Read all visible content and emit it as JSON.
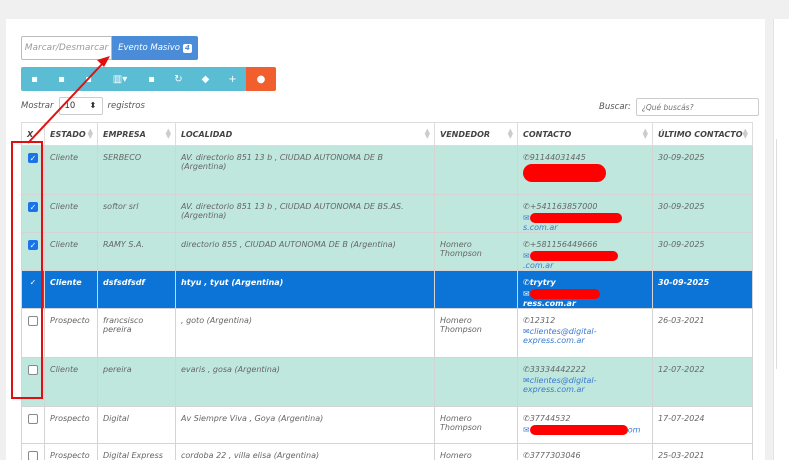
{
  "mass_actions": {
    "toggle_label": "Marcar/Desmarcar",
    "evento_label": "Evento Masivo",
    "evento_badge": "4"
  },
  "length": {
    "prefix": "Mostrar",
    "value": "10",
    "suffix": "registros"
  },
  "search": {
    "label": "Buscar:",
    "placeholder": "¿Qué buscás?"
  },
  "columns": [
    "X",
    "ESTADO",
    "EMPRESA",
    "LOCALIDAD",
    "VENDEDOR",
    "CONTACTO",
    "ÚLTIMO CONTACTO"
  ],
  "rows": [
    {
      "checked": true,
      "estado": "Cliente",
      "empresa": "SERBECO",
      "localidad": "AV. directorio 851 13 b , CIUDAD AUTONOMA DE B (Argentina)",
      "vendedor": "",
      "phone": "91144031445",
      "email_suffix": "",
      "ultimo": "30-09-2025"
    },
    {
      "checked": true,
      "estado": "Cliente",
      "empresa": "softor srl",
      "localidad": "AV. directorio 851 13 b , CIUDAD AUTONOMA DE BS.AS. (Argentina)",
      "vendedor": "",
      "phone": "+541163857000",
      "email_suffix": "s.com.ar",
      "ultimo": "30-09-2025"
    },
    {
      "checked": true,
      "estado": "Cliente",
      "empresa": "RAMY S.A.",
      "localidad": "directorio 855 , CIUDAD AUTONOMA DE B (Argentina)",
      "vendedor": "Homero Thompson",
      "phone": "+581156449666",
      "email_suffix": ".com.ar",
      "ultimo": "30-09-2025"
    },
    {
      "checked": true,
      "estado": "Cliente",
      "empresa": "dsfsdfsdf",
      "localidad": "htyu , tyut (Argentina)",
      "vendedor": "",
      "phone": "trytry",
      "email_suffix": "ress.com.ar",
      "ultimo": "30-09-2025"
    },
    {
      "checked": false,
      "estado": "Prospecto",
      "empresa": "francsisco pereira",
      "localidad": ", goto (Argentina)",
      "vendedor": "Homero Thompson",
      "phone": "12312",
      "email_suffix": "clientes@digital-express.com.ar",
      "ultimo": "26-03-2021"
    },
    {
      "checked": false,
      "estado": "Cliente",
      "empresa": "pereira",
      "localidad": "evaris , gosa (Argentina)",
      "vendedor": "",
      "phone": "33334442222",
      "email_suffix": "clientes@digital-express.com.ar",
      "ultimo": "12-07-2022"
    },
    {
      "checked": false,
      "estado": "Prospecto",
      "empresa": "Digital",
      "localidad": "Av Siempre Viva , Goya (Argentina)",
      "vendedor": "Homero Thompson",
      "phone": "37744532",
      "email_suffix": "om",
      "ultimo": "17-07-2024"
    },
    {
      "checked": false,
      "estado": "Prospecto",
      "empresa": "Digital Express",
      "localidad": "cordoba 22 , villa elisa (Argentina)",
      "vendedor": "Homero Thompson",
      "phone": "3777303046",
      "email_suffix": "",
      "ultimo": "25-03-2021"
    }
  ]
}
